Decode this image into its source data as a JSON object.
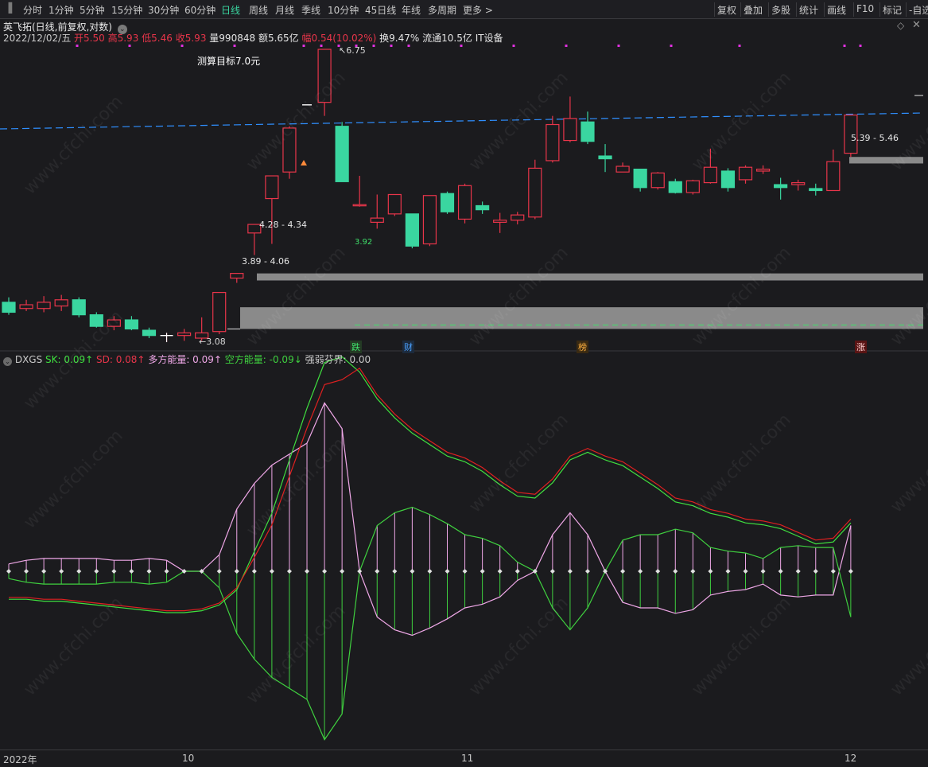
{
  "toolbar": {
    "periods": [
      "分时",
      "1分钟",
      "5分钟",
      "15分钟",
      "30分钟",
      "60分钟",
      "日线",
      "周线",
      "月线",
      "季线",
      "10分钟",
      "45日线",
      "年线",
      "多周期",
      "更多 >"
    ],
    "active": "日线",
    "right": [
      "复权",
      "叠加",
      "多股",
      "统计",
      "画线",
      "F10",
      "标记",
      "-自选"
    ]
  },
  "stock": {
    "title": "英飞拓(日线,前复权,对数)",
    "date": "2022/12/02/五",
    "open": "开5.50",
    "high": "高5.93",
    "low": "低5.46",
    "close": "收5.93",
    "volume": "量990848",
    "amount": "额5.65亿",
    "change": "幅0.54(10.02%)",
    "turnover": "换9.47%",
    "float_cap": "流通10.5亿",
    "sector": "IT设备"
  },
  "annotations": {
    "target": "测算目标7.0元",
    "high_label": "6.75",
    "low_label": "3.08",
    "zone_upper": "4.28 - 4.34",
    "zone_lower": "3.89 - 4.06",
    "zone_right": "5.39 - 5.46",
    "green_line": "3.92"
  },
  "events": [
    {
      "label": "跌",
      "color": "#e04040",
      "bg": "#1a3a1a",
      "fg": "#3fe06a"
    },
    {
      "label": "财",
      "color": "#4aa0ff",
      "bg": "#1a2a3a",
      "fg": "#4aa0ff"
    },
    {
      "label": "榜",
      "color": "#ffb040",
      "bg": "#3a2a10",
      "fg": "#ffb040"
    },
    {
      "label": "涨",
      "color": "#ff5050",
      "bg": "#5a1010",
      "fg": "#ffd0d0"
    }
  ],
  "indicator": {
    "name": "DXGS",
    "sk": "SK: 0.09↑",
    "sd": "SD: 0.08↑",
    "bull": "多方能量: 0.09↑",
    "bear": "空方能量: -0.09↓",
    "line": "强弱芬界: 0.00"
  },
  "xaxis": {
    "year": "2022年",
    "m10": "10",
    "m11": "11",
    "m12": "12"
  },
  "watermark": "www.cfchi.com",
  "colors": {
    "up": "#e8354a",
    "down": "#3ad6a0",
    "ma": "#2f8fff",
    "sk": "#3fe03f",
    "sd": "#e02020",
    "bull": "#f0a8e8",
    "bear": "#3fd03f",
    "grey_zone": "#8a8a8a"
  },
  "chart_data": {
    "type": "candlestick",
    "candles": [
      {
        "o": 4.1,
        "h": 4.14,
        "l": 4.0,
        "c": 4.02
      },
      {
        "o": 4.05,
        "h": 4.12,
        "l": 4.03,
        "c": 4.08
      },
      {
        "o": 4.05,
        "h": 4.15,
        "l": 4.02,
        "c": 4.1
      },
      {
        "o": 4.07,
        "h": 4.16,
        "l": 4.03,
        "c": 4.12
      },
      {
        "o": 4.12,
        "h": 4.14,
        "l": 3.98,
        "c": 4.0
      },
      {
        "o": 4.0,
        "h": 4.02,
        "l": 3.9,
        "c": 3.91
      },
      {
        "o": 3.91,
        "h": 3.99,
        "l": 3.88,
        "c": 3.96
      },
      {
        "o": 3.96,
        "h": 3.99,
        "l": 3.88,
        "c": 3.89
      },
      {
        "o": 3.88,
        "h": 3.9,
        "l": 3.82,
        "c": 3.84
      },
      {
        "o": 3.84,
        "h": 3.86,
        "l": 3.79,
        "c": 3.84
      },
      {
        "o": 3.84,
        "h": 3.89,
        "l": 3.8,
        "c": 3.86
      },
      {
        "o": 3.82,
        "h": 3.98,
        "l": 3.8,
        "c": 3.86
      },
      {
        "o": 3.87,
        "h": 4.18,
        "l": 3.85,
        "c": 4.18
      },
      {
        "o": 4.3,
        "h": 4.31,
        "l": 4.26,
        "c": 4.34
      },
      {
        "o": 4.7,
        "h": 4.77,
        "l": 4.5,
        "c": 4.78
      },
      {
        "o": 5.03,
        "h": 5.25,
        "l": 4.6,
        "c": 5.26
      },
      {
        "o": 5.3,
        "h": 5.8,
        "l": 5.23,
        "c": 5.78
      },
      {
        "o": 6.05,
        "h": 6.05,
        "l": 6.05,
        "c": 6.05
      },
      {
        "o": 6.08,
        "h": 6.75,
        "l": 5.92,
        "c": 6.75
      },
      {
        "o": 5.8,
        "h": 5.85,
        "l": 5.2,
        "c": 5.2
      },
      {
        "o": 4.97,
        "h": 5.26,
        "l": 4.95,
        "c": 4.97
      },
      {
        "o": 4.8,
        "h": 5.07,
        "l": 4.74,
        "c": 4.84
      },
      {
        "o": 4.88,
        "h": 5.07,
        "l": 4.86,
        "c": 5.07
      },
      {
        "o": 4.88,
        "h": 4.88,
        "l": 4.56,
        "c": 4.58
      },
      {
        "o": 4.6,
        "h": 5.06,
        "l": 4.58,
        "c": 5.06
      },
      {
        "o": 5.08,
        "h": 5.1,
        "l": 4.88,
        "c": 4.9
      },
      {
        "o": 4.83,
        "h": 5.18,
        "l": 4.79,
        "c": 5.16
      },
      {
        "o": 4.96,
        "h": 5.0,
        "l": 4.88,
        "c": 4.92
      },
      {
        "o": 4.8,
        "h": 4.89,
        "l": 4.7,
        "c": 4.82
      },
      {
        "o": 4.82,
        "h": 4.9,
        "l": 4.78,
        "c": 4.87
      },
      {
        "o": 4.85,
        "h": 5.43,
        "l": 4.83,
        "c": 5.34
      },
      {
        "o": 5.42,
        "h": 5.92,
        "l": 5.4,
        "c": 5.82
      },
      {
        "o": 5.64,
        "h": 6.15,
        "l": 5.62,
        "c": 5.89
      },
      {
        "o": 5.85,
        "h": 5.97,
        "l": 5.6,
        "c": 5.63
      },
      {
        "o": 5.47,
        "h": 5.6,
        "l": 5.3,
        "c": 5.44
      },
      {
        "o": 5.3,
        "h": 5.4,
        "l": 5.3,
        "c": 5.36
      },
      {
        "o": 5.33,
        "h": 5.33,
        "l": 5.1,
        "c": 5.14
      },
      {
        "o": 5.14,
        "h": 5.3,
        "l": 5.12,
        "c": 5.29
      },
      {
        "o": 5.2,
        "h": 5.23,
        "l": 5.08,
        "c": 5.09
      },
      {
        "o": 5.09,
        "h": 5.22,
        "l": 5.07,
        "c": 5.21
      },
      {
        "o": 5.19,
        "h": 5.55,
        "l": 5.18,
        "c": 5.35
      },
      {
        "o": 5.31,
        "h": 5.34,
        "l": 5.1,
        "c": 5.14
      },
      {
        "o": 5.22,
        "h": 5.37,
        "l": 5.18,
        "c": 5.35
      },
      {
        "o": 5.31,
        "h": 5.37,
        "l": 5.28,
        "c": 5.33
      },
      {
        "o": 5.17,
        "h": 5.24,
        "l": 5.02,
        "c": 5.14
      },
      {
        "o": 5.17,
        "h": 5.22,
        "l": 5.11,
        "c": 5.19
      },
      {
        "o": 5.13,
        "h": 5.18,
        "l": 5.06,
        "c": 5.11
      },
      {
        "o": 5.11,
        "h": 5.54,
        "l": 5.11,
        "c": 5.41
      },
      {
        "o": 5.5,
        "h": 5.93,
        "l": 5.46,
        "c": 5.93
      }
    ]
  }
}
